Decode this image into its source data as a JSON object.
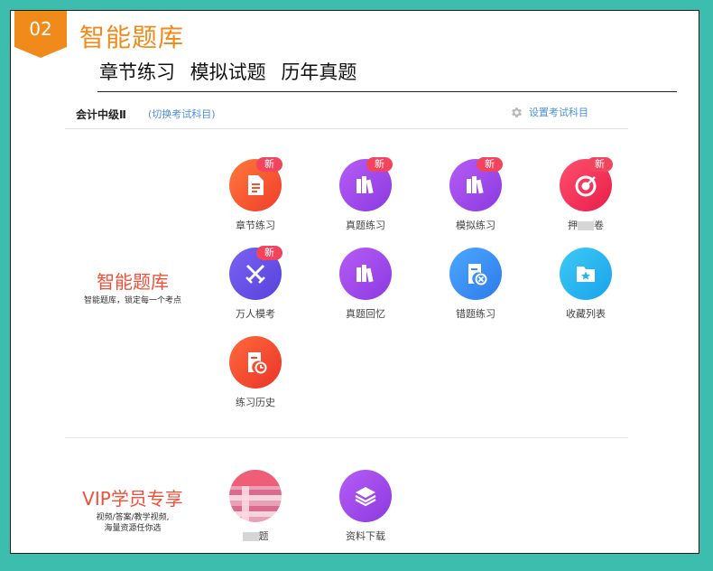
{
  "header": {
    "badge": "02",
    "title": "智能题库",
    "subtitle": "章节练习  模拟试题  历年真题"
  },
  "bar": {
    "subject": "会计中级Ⅱ",
    "switch_link": "(切换考试科目)",
    "settings": "设置考试科目"
  },
  "sections": {
    "bank": {
      "title": "智能题库",
      "desc": "智能题库，锁定每一个考点"
    },
    "vip": {
      "title": "VIP学员专享",
      "desc_line1": "视频/答案/教学视频,",
      "desc_line2": "海量资源任你选"
    }
  },
  "badges": {
    "new": "新"
  },
  "tiles": [
    {
      "label": "章节练习",
      "icon": "document-icon",
      "color": "#f2552a",
      "new": true
    },
    {
      "label": "真题练习",
      "icon": "books-icon",
      "color": "#9f4bea",
      "new": true
    },
    {
      "label": "模拟练习",
      "icon": "books-icon",
      "color": "#9a4ae8",
      "new": true
    },
    {
      "label_a": "押",
      "label_b": "卷",
      "icon": "target-icon",
      "color": "#f02d58",
      "new": true
    },
    {
      "label": "万人模考",
      "icon": "crossed-swords-icon",
      "color": "#6b56e8",
      "new": true
    },
    {
      "label": "真题回忆",
      "icon": "books-icon",
      "color": "#9a4ae8",
      "new": false
    },
    {
      "label": "错题练习",
      "icon": "wrong-answer-icon",
      "color": "#3a8ff0",
      "new": false
    },
    {
      "label": "收藏列表",
      "icon": "star-folder-icon",
      "color": "#26b4f0",
      "new": false
    },
    {
      "label": "练习历史",
      "icon": "history-icon",
      "color": "#f2452d",
      "new": false
    }
  ],
  "vip_tiles": [
    {
      "label_b": "题",
      "icon": "blurred-image",
      "color": "#f05d76"
    },
    {
      "label": "资料下载",
      "icon": "layers-icon",
      "color": "#9a4ae8"
    }
  ]
}
